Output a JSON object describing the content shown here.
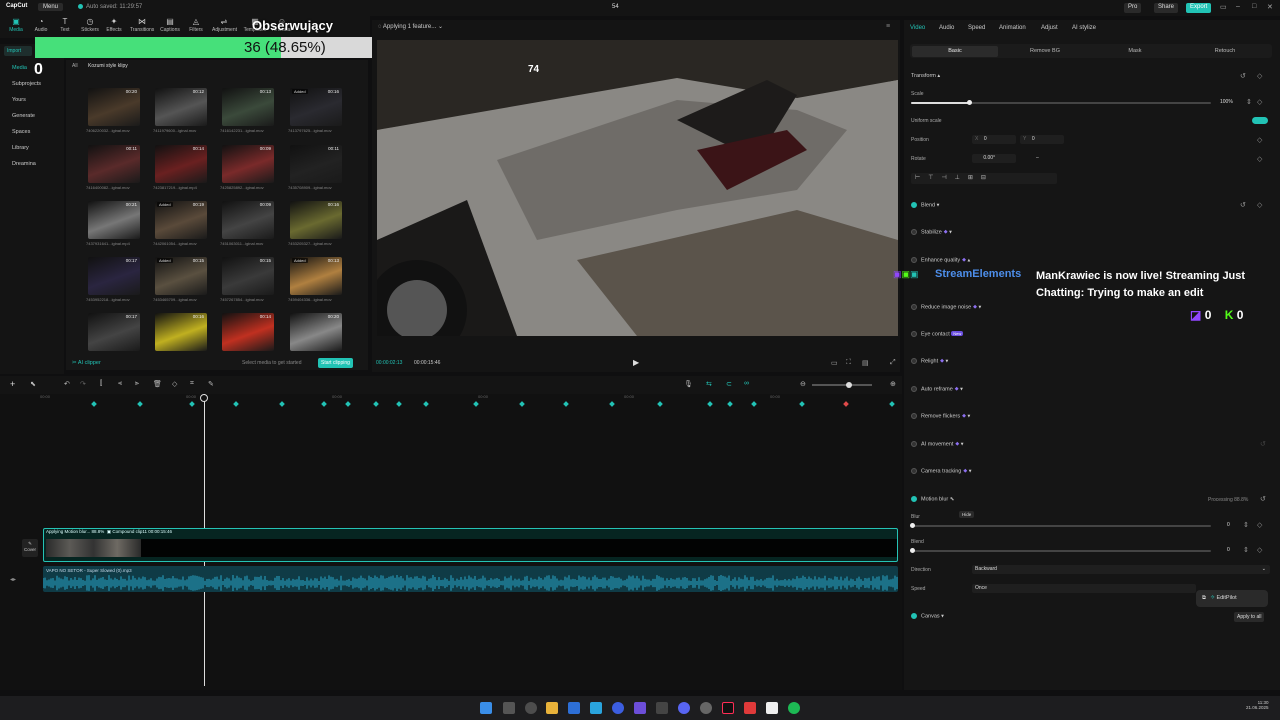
{
  "topbar": {
    "app": "CapCut",
    "menu": "Menu",
    "autosave": "Auto saved: 11:29:57",
    "project": "54",
    "pro": "Pro",
    "share": "Share",
    "export": "Export"
  },
  "tools": [
    "Media",
    "Audio",
    "Text",
    "Stickers",
    "Effects",
    "Transitions",
    "Captions",
    "Filters",
    "Adjustment",
    "Templates",
    "AI avatar"
  ],
  "leftnav": {
    "import": "Import",
    "media": "Media",
    "subprojects": "Subprojects",
    "yours": "Yours",
    "generate": "Generate",
    "spaces": "Spaces",
    "library": "Library",
    "dreamina": "Dreamina"
  },
  "media": {
    "tabs": [
      "All",
      "Kozumi style klipy"
    ],
    "clips": [
      {
        "dur": "00:20",
        "name": "7406220032...iginal.mov",
        "added": ""
      },
      {
        "dur": "00:12",
        "name": "7411979600...iginal.mov",
        "added": ""
      },
      {
        "dur": "00:13",
        "name": "7416142231...iginal.mov",
        "added": ""
      },
      {
        "dur": "00:16",
        "name": "7413797625...iginal.mov",
        "added": "Added"
      },
      {
        "dur": "00:11",
        "name": "7416400082...iginal.mov",
        "added": ""
      },
      {
        "dur": "00:14",
        "name": "7423817219...iginal.mp4",
        "added": ""
      },
      {
        "dur": "00:09",
        "name": "7425825892...iginal.mov",
        "added": ""
      },
      {
        "dur": "00:11",
        "name": "7435708909...iginal.mov",
        "added": ""
      },
      {
        "dur": "00:21",
        "name": "7437931641...iginal.mp4",
        "added": ""
      },
      {
        "dur": "00:19",
        "name": "7442061054...iginal.mov",
        "added": "Added"
      },
      {
        "dur": "00:09",
        "name": "7451063011...iginal.mov",
        "added": ""
      },
      {
        "dur": "00:16",
        "name": "7453205327...iginal.mov",
        "added": ""
      },
      {
        "dur": "00:17",
        "name": "7453952218...iginal.mov",
        "added": ""
      },
      {
        "dur": "00:15",
        "name": "7453465709...iginal.mov",
        "added": "Added"
      },
      {
        "dur": "00:15",
        "name": "7457267854...iginal.mov",
        "added": ""
      },
      {
        "dur": "00:13",
        "name": "7459404336...iginal.mov",
        "added": "Added"
      },
      {
        "dur": "00:17",
        "name": "",
        "added": ""
      },
      {
        "dur": "00:16",
        "name": "",
        "added": ""
      },
      {
        "dur": "00:14",
        "name": "",
        "added": ""
      },
      {
        "dur": "00:20",
        "name": "",
        "added": ""
      }
    ],
    "ai_clipper": "AI clipper",
    "hint": "Select media to get started",
    "start_clipping": "Start clipping"
  },
  "stream_overlay": {
    "title": "Obserwujący",
    "progress_text": "36 (48.65%)",
    "progress": 0.4865,
    "media_count": "0",
    "viewers": "74"
  },
  "player": {
    "status": "Applying 1 feature...",
    "current_time": "00:00:02:13",
    "total_time": "00:00:15:46"
  },
  "timeline": {
    "video_clip_label": "Applying Motion blur... 88.8%",
    "compound_label": "Compound clip11  00:00:15:46",
    "cover": "Cover",
    "audio_label": "VAPO NO SETOR - Super Slowed (0).mp3",
    "ruler": [
      "00:00",
      "",
      "00:00",
      "",
      "00:00",
      "",
      "00:00",
      "",
      "00:00",
      "",
      "00:00"
    ]
  },
  "right": {
    "tabs": [
      "Video",
      "Audio",
      "Speed",
      "Animation",
      "Adjust",
      "AI stylize"
    ],
    "subtabs": [
      "Basic",
      "Remove BG",
      "Mask",
      "Retouch"
    ],
    "transform": "Transform",
    "scale": "Scale",
    "scale_value": "100%",
    "uniform_scale": "Uniform scale",
    "position": "Position",
    "pos_x": "0",
    "pos_y": "0",
    "rotate": "Rotate",
    "rotate_value": "0.00°",
    "rotate_sign": "–",
    "blend": "Blend",
    "stabilize": "Stabilize",
    "enhance_quality": "Enhance quality",
    "reduce_noise": "Reduce image noise",
    "eye_contact": "Eye contact",
    "eye_badge": "New",
    "relight": "Relight",
    "auto_reframe": "Auto reframe",
    "remove_flickers": "Remove flickers",
    "ai_movement": "AI movement",
    "camera_tracking": "Camera tracking",
    "motion_blur": "Motion blur",
    "hide": "Hide",
    "processing": "Processing 88.8%",
    "blur": "Blur",
    "blur_value": "0",
    "blend2": "Blend",
    "blend2_value": "0",
    "direction": "Direction",
    "direction_value": "Backward",
    "speed": "Speed",
    "speed_value": "Once",
    "canvas": "Canvas",
    "editpilot": "EditPilot",
    "apply_all": "Apply to all"
  },
  "streamelements": {
    "name": "StreamElements",
    "message": "ManKrawiec is now live! Streaming Just Chatting: Trying to make an edit",
    "count1": "0",
    "count2": "0"
  },
  "taskbar": {
    "clock_time": "11:30",
    "clock_date": "21.06.2025"
  }
}
